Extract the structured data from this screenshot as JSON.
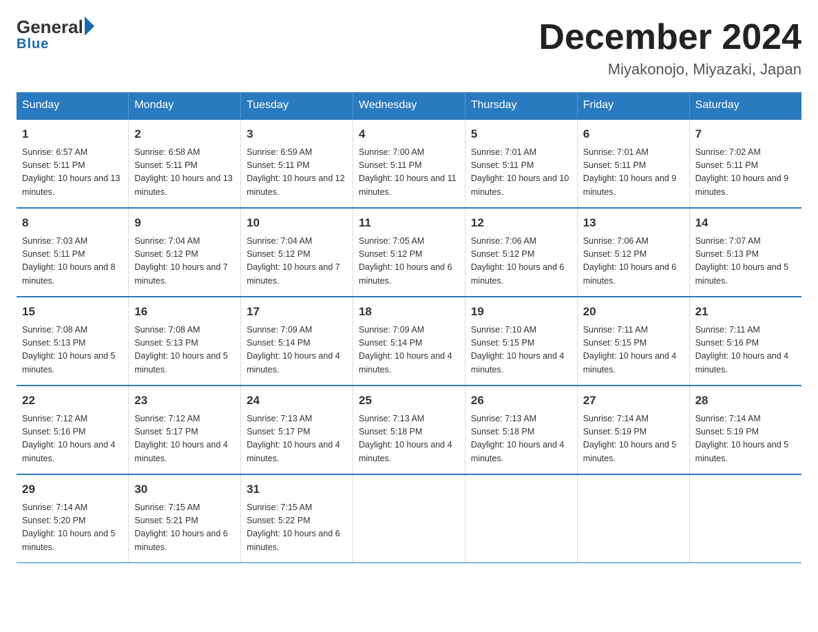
{
  "header": {
    "logo_general": "General",
    "logo_blue": "Blue",
    "calendar_title": "December 2024",
    "calendar_subtitle": "Miyakonojo, Miyazaki, Japan"
  },
  "days_of_week": [
    "Sunday",
    "Monday",
    "Tuesday",
    "Wednesday",
    "Thursday",
    "Friday",
    "Saturday"
  ],
  "weeks": [
    [
      {
        "day": "1",
        "sunrise": "6:57 AM",
        "sunset": "5:11 PM",
        "daylight": "10 hours and 13 minutes."
      },
      {
        "day": "2",
        "sunrise": "6:58 AM",
        "sunset": "5:11 PM",
        "daylight": "10 hours and 13 minutes."
      },
      {
        "day": "3",
        "sunrise": "6:59 AM",
        "sunset": "5:11 PM",
        "daylight": "10 hours and 12 minutes."
      },
      {
        "day": "4",
        "sunrise": "7:00 AM",
        "sunset": "5:11 PM",
        "daylight": "10 hours and 11 minutes."
      },
      {
        "day": "5",
        "sunrise": "7:01 AM",
        "sunset": "5:11 PM",
        "daylight": "10 hours and 10 minutes."
      },
      {
        "day": "6",
        "sunrise": "7:01 AM",
        "sunset": "5:11 PM",
        "daylight": "10 hours and 9 minutes."
      },
      {
        "day": "7",
        "sunrise": "7:02 AM",
        "sunset": "5:11 PM",
        "daylight": "10 hours and 9 minutes."
      }
    ],
    [
      {
        "day": "8",
        "sunrise": "7:03 AM",
        "sunset": "5:11 PM",
        "daylight": "10 hours and 8 minutes."
      },
      {
        "day": "9",
        "sunrise": "7:04 AM",
        "sunset": "5:12 PM",
        "daylight": "10 hours and 7 minutes."
      },
      {
        "day": "10",
        "sunrise": "7:04 AM",
        "sunset": "5:12 PM",
        "daylight": "10 hours and 7 minutes."
      },
      {
        "day": "11",
        "sunrise": "7:05 AM",
        "sunset": "5:12 PM",
        "daylight": "10 hours and 6 minutes."
      },
      {
        "day": "12",
        "sunrise": "7:06 AM",
        "sunset": "5:12 PM",
        "daylight": "10 hours and 6 minutes."
      },
      {
        "day": "13",
        "sunrise": "7:06 AM",
        "sunset": "5:12 PM",
        "daylight": "10 hours and 6 minutes."
      },
      {
        "day": "14",
        "sunrise": "7:07 AM",
        "sunset": "5:13 PM",
        "daylight": "10 hours and 5 minutes."
      }
    ],
    [
      {
        "day": "15",
        "sunrise": "7:08 AM",
        "sunset": "5:13 PM",
        "daylight": "10 hours and 5 minutes."
      },
      {
        "day": "16",
        "sunrise": "7:08 AM",
        "sunset": "5:13 PM",
        "daylight": "10 hours and 5 minutes."
      },
      {
        "day": "17",
        "sunrise": "7:09 AM",
        "sunset": "5:14 PM",
        "daylight": "10 hours and 4 minutes."
      },
      {
        "day": "18",
        "sunrise": "7:09 AM",
        "sunset": "5:14 PM",
        "daylight": "10 hours and 4 minutes."
      },
      {
        "day": "19",
        "sunrise": "7:10 AM",
        "sunset": "5:15 PM",
        "daylight": "10 hours and 4 minutes."
      },
      {
        "day": "20",
        "sunrise": "7:11 AM",
        "sunset": "5:15 PM",
        "daylight": "10 hours and 4 minutes."
      },
      {
        "day": "21",
        "sunrise": "7:11 AM",
        "sunset": "5:16 PM",
        "daylight": "10 hours and 4 minutes."
      }
    ],
    [
      {
        "day": "22",
        "sunrise": "7:12 AM",
        "sunset": "5:16 PM",
        "daylight": "10 hours and 4 minutes."
      },
      {
        "day": "23",
        "sunrise": "7:12 AM",
        "sunset": "5:17 PM",
        "daylight": "10 hours and 4 minutes."
      },
      {
        "day": "24",
        "sunrise": "7:13 AM",
        "sunset": "5:17 PM",
        "daylight": "10 hours and 4 minutes."
      },
      {
        "day": "25",
        "sunrise": "7:13 AM",
        "sunset": "5:18 PM",
        "daylight": "10 hours and 4 minutes."
      },
      {
        "day": "26",
        "sunrise": "7:13 AM",
        "sunset": "5:18 PM",
        "daylight": "10 hours and 4 minutes."
      },
      {
        "day": "27",
        "sunrise": "7:14 AM",
        "sunset": "5:19 PM",
        "daylight": "10 hours and 5 minutes."
      },
      {
        "day": "28",
        "sunrise": "7:14 AM",
        "sunset": "5:19 PM",
        "daylight": "10 hours and 5 minutes."
      }
    ],
    [
      {
        "day": "29",
        "sunrise": "7:14 AM",
        "sunset": "5:20 PM",
        "daylight": "10 hours and 5 minutes."
      },
      {
        "day": "30",
        "sunrise": "7:15 AM",
        "sunset": "5:21 PM",
        "daylight": "10 hours and 6 minutes."
      },
      {
        "day": "31",
        "sunrise": "7:15 AM",
        "sunset": "5:22 PM",
        "daylight": "10 hours and 6 minutes."
      },
      null,
      null,
      null,
      null
    ]
  ]
}
